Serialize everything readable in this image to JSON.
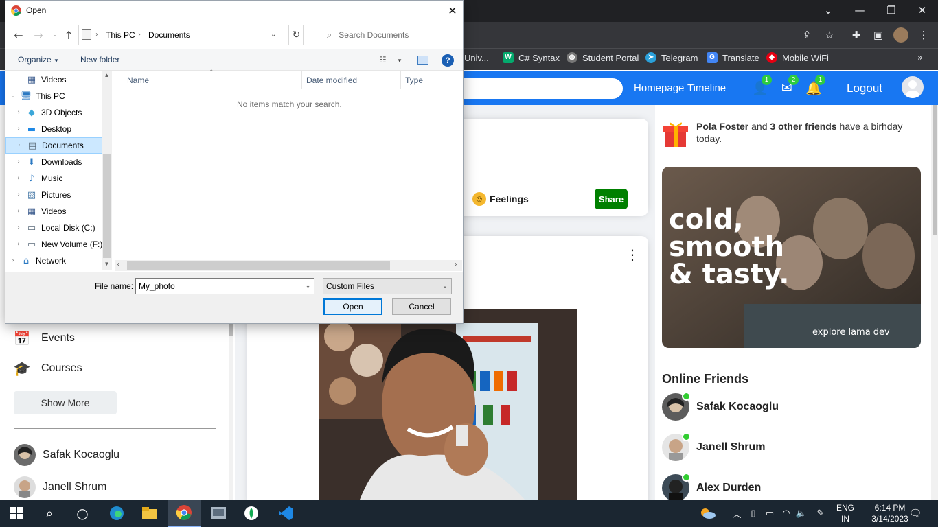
{
  "chrome": {
    "bookmarks": [
      {
        "label": "Univ...",
        "icon": "link-icon"
      },
      {
        "label": "C# Syntax",
        "icon": "w3schools-icon"
      },
      {
        "label": "Student Portal",
        "icon": "globe-icon"
      },
      {
        "label": "Telegram",
        "icon": "telegram-icon"
      },
      {
        "label": "Translate",
        "icon": "translate-icon"
      },
      {
        "label": "Mobile WiFi",
        "icon": "wifi-brand-icon"
      }
    ]
  },
  "header": {
    "nav": [
      "Homepage",
      "Timeline"
    ],
    "badges": {
      "friends": "1",
      "messages": "2",
      "notifications": "1"
    },
    "logout": "Logout"
  },
  "sidebar": {
    "items": [
      {
        "label": "Events",
        "icon": "calendar-icon"
      },
      {
        "label": "Courses",
        "icon": "school-icon"
      }
    ],
    "show_more": "Show More",
    "friends": [
      "Safak Kocaoglu",
      "Janell Shrum"
    ]
  },
  "share": {
    "feelings": "Feelings",
    "share_button": "Share"
  },
  "rightbar": {
    "birthday_name": "Pola Foster",
    "birthday_and": " and ",
    "birthday_others": "3 other friends",
    "birthday_rest": " have a birhday today.",
    "ad": {
      "line1": "cold,",
      "line2": "smooth",
      "line3": "& tasty.",
      "tagline": "explore lama dev"
    },
    "online_title": "Online Friends",
    "online_friends": [
      "Safak Kocaoglu",
      "Janell Shrum",
      "Alex Durden"
    ]
  },
  "dialog": {
    "title": "Open",
    "breadcrumb": [
      "This PC",
      "Documents"
    ],
    "search_placeholder": "Search Documents",
    "toolbar": {
      "organize": "Organize",
      "new_folder": "New folder"
    },
    "tree": [
      {
        "label": "Videos",
        "icon": "video-folder-icon",
        "arrow": "",
        "indent": 1
      },
      {
        "label": "This PC",
        "icon": "computer-icon",
        "arrow": "⌄",
        "indent": 0
      },
      {
        "label": "3D Objects",
        "icon": "cube-icon",
        "arrow": "›",
        "indent": 1
      },
      {
        "label": "Desktop",
        "icon": "desktop-icon",
        "arrow": "›",
        "indent": 1
      },
      {
        "label": "Documents",
        "icon": "documents-icon",
        "arrow": "›",
        "indent": 1
      },
      {
        "label": "Downloads",
        "icon": "download-icon",
        "arrow": "›",
        "indent": 1
      },
      {
        "label": "Music",
        "icon": "music-icon",
        "arrow": "›",
        "indent": 1
      },
      {
        "label": "Pictures",
        "icon": "pictures-icon",
        "arrow": "›",
        "indent": 1
      },
      {
        "label": "Videos",
        "icon": "video-folder-icon",
        "arrow": "›",
        "indent": 1
      },
      {
        "label": "Local Disk (C:)",
        "icon": "drive-icon",
        "arrow": "›",
        "indent": 1
      },
      {
        "label": "New Volume (F:)",
        "icon": "drive-icon",
        "arrow": "›",
        "indent": 1
      },
      {
        "label": "Network",
        "icon": "network-icon",
        "arrow": "›",
        "indent": 0
      }
    ],
    "selected_tree_item": "Documents",
    "columns": [
      "Name",
      "Date modified",
      "Type"
    ],
    "empty_message": "No items match your search.",
    "file_name_label": "File name:",
    "file_name_value": "My_photo",
    "file_type": "Custom Files",
    "open_button": "Open",
    "cancel_button": "Cancel"
  },
  "taskbar": {
    "lang1": "ENG",
    "lang2": "IN",
    "time": "6:14 PM",
    "date": "3/14/2023"
  },
  "colors": {
    "brand_blue": "#1877f2",
    "share_green": "#008000",
    "online_green": "#32cd32",
    "taskbar": "#1b2631",
    "chrome_dark": "#202124"
  }
}
